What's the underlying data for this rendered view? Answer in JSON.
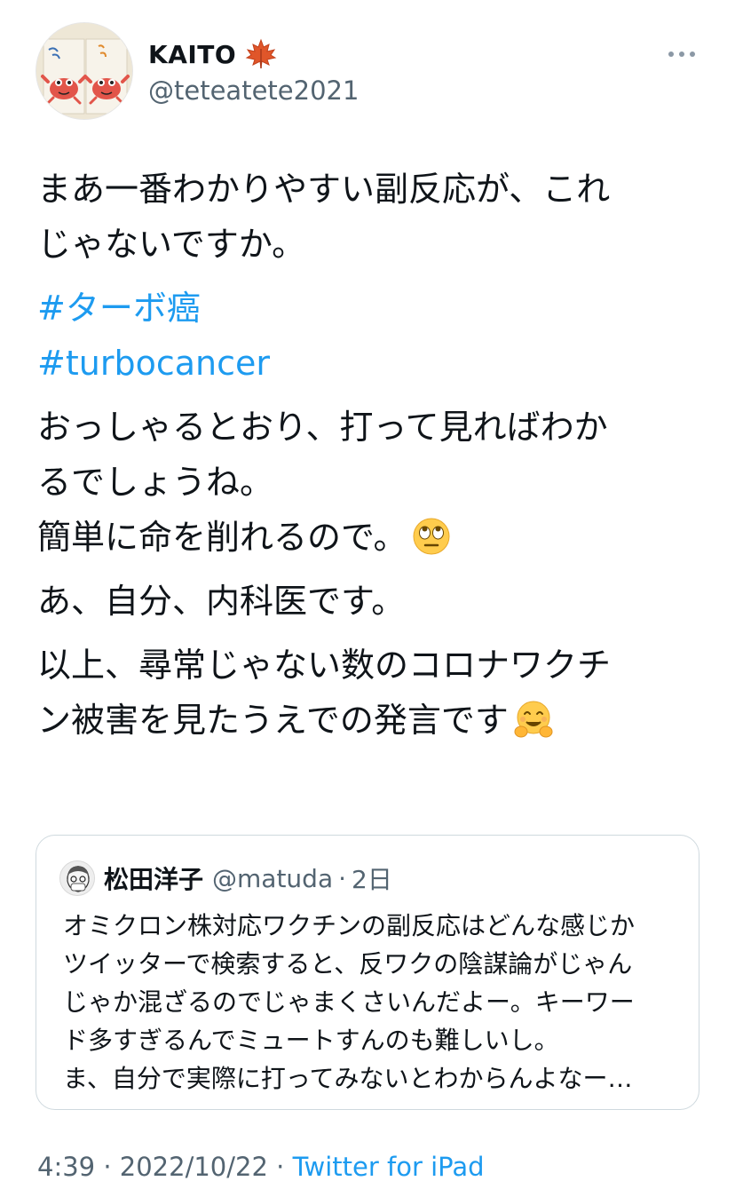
{
  "author": {
    "display_name": "KAITO",
    "handle": "@teteatete2021",
    "badge_icon": "maple-leaf-icon",
    "avatar_icon": "crab-drawing-icon"
  },
  "tweet": {
    "paragraph1": [
      "まあ一番わかりやすい副反応が、これ",
      "じゃないですか。"
    ],
    "hashtags": [
      "#ターボ癌",
      "#turbocancer"
    ],
    "paragraph2": [
      "おっしゃるとおり、打って見ればわか",
      "るでしょうね。",
      "簡単に命を削れるので。"
    ],
    "paragraph3": "あ、自分、内科医です。",
    "paragraph4": [
      "以上、尋常じゃない数のコロナワクチ",
      "ン被害を見たうえでの発言です"
    ],
    "emoji_1": "face-with-rolling-eyes-emoji",
    "emoji_2": "hugging-face-emoji"
  },
  "quote": {
    "display_name": "松田洋子",
    "handle": "@matuda",
    "separator": "·",
    "time": "2日",
    "lines": [
      "オミクロン株対応ワクチンの副反応はどんな感じか",
      "ツイッターで検索すると、反ワクの陰謀論がじゃん",
      "じゃか混ざるのでじゃまくさいんだよー。キーワー",
      "ド多すぎるんでミュートすんのも難しいし。",
      "ま、自分で実際に打ってみないとわからんよなー…"
    ]
  },
  "meta": {
    "time": "4:39",
    "sep1": " · ",
    "date": "2022/10/22",
    "sep2": " · ",
    "source": "Twitter for iPad"
  },
  "colors": {
    "link": "#1d9bf0",
    "secondary_text": "#536471",
    "text": "#0f1419",
    "border": "#cfd9de"
  }
}
